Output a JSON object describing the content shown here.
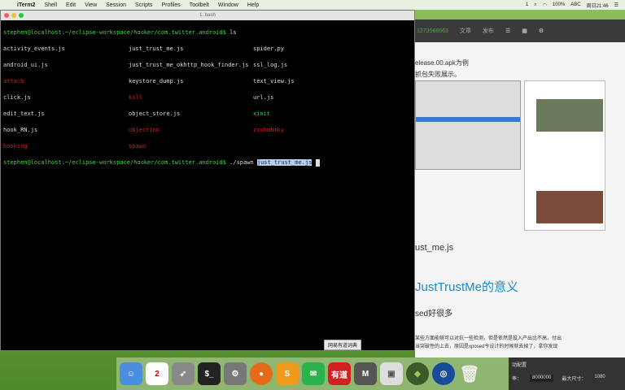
{
  "menubar": {
    "items": [
      "iTerm2",
      "Shell",
      "Edit",
      "View",
      "Session",
      "Scripts",
      "Profiles",
      "Toolbelt",
      "Window",
      "Help"
    ],
    "status": [
      "1",
      "100%",
      "ABC",
      "周日21:46"
    ]
  },
  "terminal": {
    "title": "1. bash",
    "prompt": "stephen@localhost:~/eclipse-workspace/hooker/com.twitter.android$",
    "cmd1": " ls",
    "ls": [
      [
        "activity_events.js",
        "just_trust_me.js",
        "spider.py"
      ],
      [
        "android_ui.js",
        "just_trust_me_okhttp_hook_finder.js",
        "ssl_log.js"
      ],
      [
        "attach",
        "keystore_dump.js",
        "text_view.js"
      ],
      [
        "click.js",
        "kill",
        "url.js"
      ],
      [
        "edit_text.js",
        "object_store.js",
        "xinit"
      ],
      [
        "hook_RN.js",
        "objection",
        "zxxbmbmky"
      ],
      [
        "hooking",
        "spawn",
        ""
      ]
    ],
    "cmd2": " ./spawn ",
    "cmd2_sel": "just_trust_me.js"
  },
  "browser": {
    "id": "1273568663",
    "btn1": "文章",
    "btn2": "发布",
    "line1": "elease.00.apk为例",
    "line2": "抓包失败展示。",
    "line3": "ust_me.js",
    "heading": "JustTrustMe的意义",
    "line4": "sed好很多",
    "para1": "某些方面能够可以对抗一些检测，但是依然是投入产出比不高，付出",
    "para2": "当突破性的上去，原因是xposed今设计的时候就去掉了，拿你发现"
  },
  "dock": {
    "tooltip": "网易有道词典",
    "calendar_day": "2",
    "youdao": "有道"
  },
  "panel": {
    "label1": "动配置",
    "label2": "率：",
    "value": "8000000",
    "label3": "最大尺寸：",
    "value2": "1080"
  }
}
